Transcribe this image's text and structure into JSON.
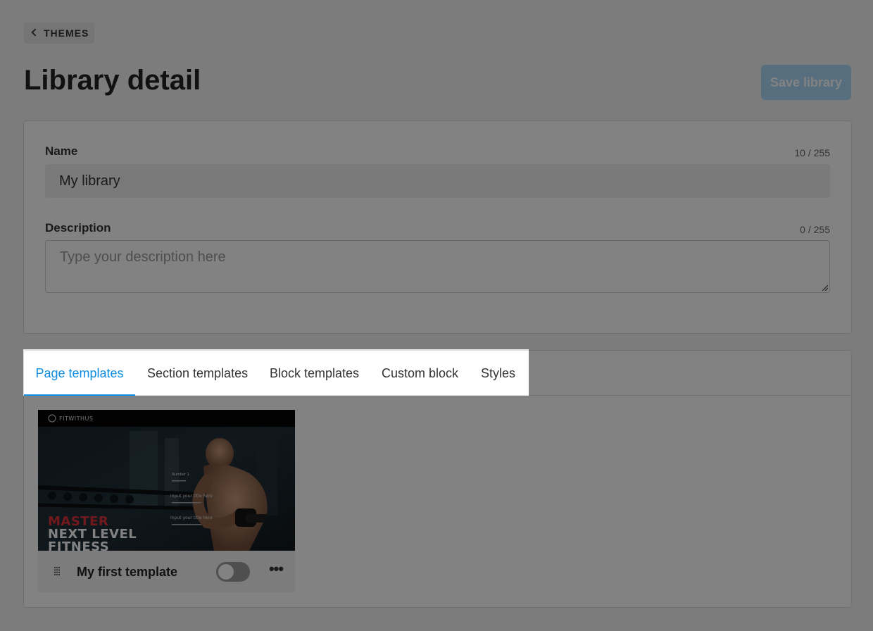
{
  "header": {
    "back_label": "THEMES",
    "title": "Library detail",
    "save_label": "Save library"
  },
  "form": {
    "name_label": "Name",
    "name_counter": "10 / 255",
    "name_value": "My library",
    "description_label": "Description",
    "description_counter": "0 / 255",
    "description_placeholder": "Type your description here"
  },
  "tabs": [
    {
      "label": "Page templates",
      "active": true
    },
    {
      "label": "Section templates",
      "active": false
    },
    {
      "label": "Block templates",
      "active": false
    },
    {
      "label": "Custom block",
      "active": false
    },
    {
      "label": "Styles",
      "active": false
    }
  ],
  "templates": [
    {
      "name": "My first template",
      "enabled": false,
      "thumbnail": {
        "brand": "FITWITHUS",
        "headline_1": "MASTER",
        "headline_2": "NEXT LEVEL",
        "headline_3": "FITNESS",
        "lines": [
          "Number 1",
          "Input your title here",
          "Input your title here"
        ]
      }
    }
  ],
  "colors": {
    "accent": "#0f8ce0",
    "save_button": "#a9d8f8",
    "headline_red": "#e0323a"
  }
}
